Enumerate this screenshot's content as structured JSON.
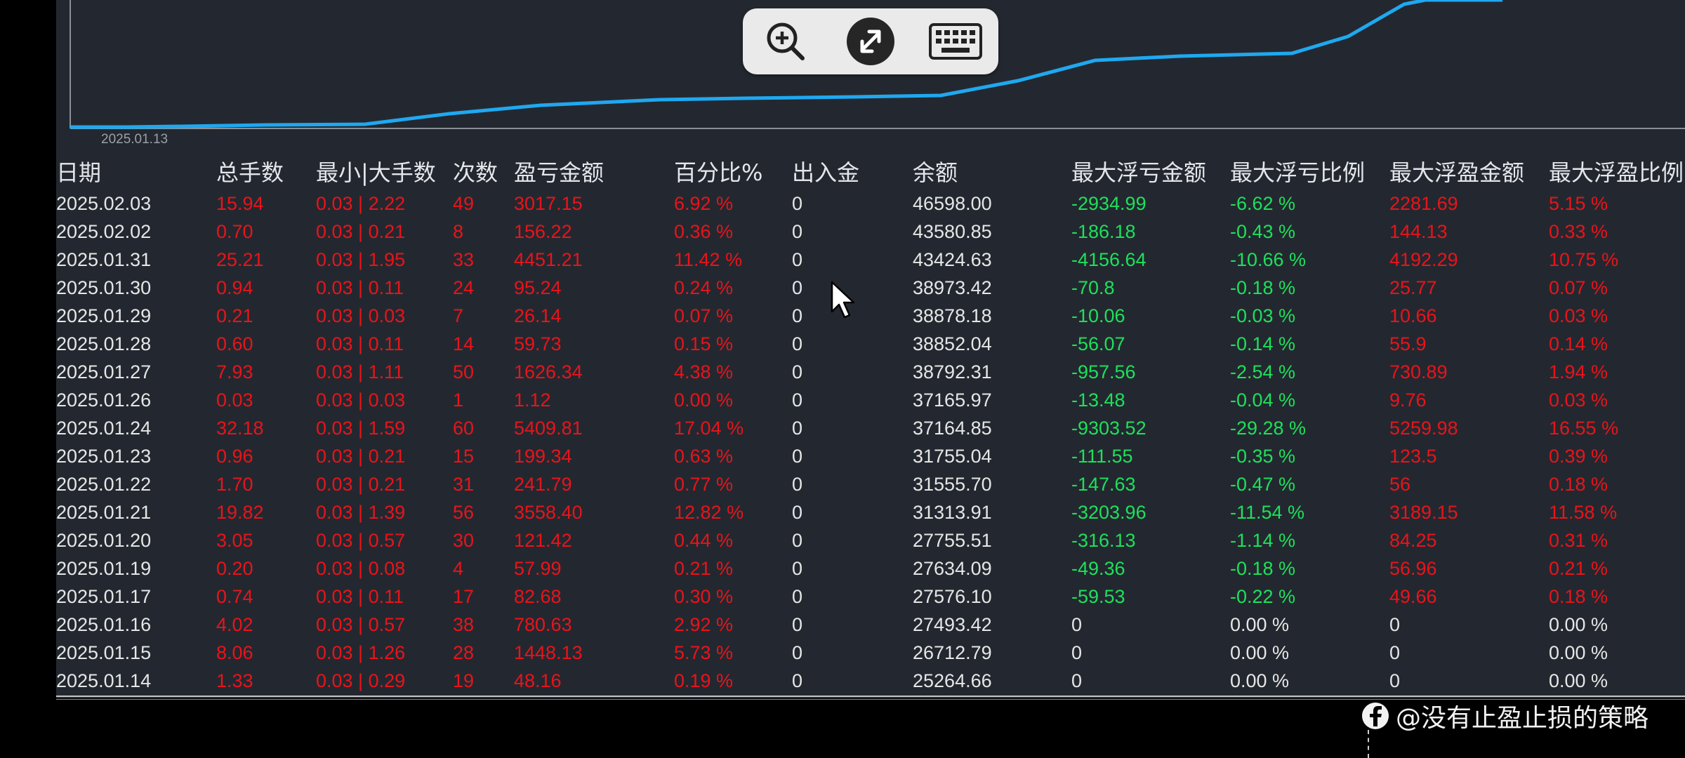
{
  "chart": {
    "axis_date": "2025.01.13",
    "line_color": "#1fa8f0"
  },
  "toolbar": {
    "zoom_icon": "zoom-in-icon",
    "remote_icon": "remote-desktop-icon",
    "keyboard_icon": "keyboard-icon"
  },
  "table": {
    "headers": [
      "日期",
      "总手数",
      "最小|大手数",
      "次数",
      "盈亏金额",
      "百分比%",
      "出入金",
      "余额",
      "最大浮亏金额",
      "最大浮亏比例",
      "最大浮盈金额",
      "最大浮盈比例"
    ],
    "rows": [
      [
        "2025.02.03",
        "15.94",
        "0.03 | 2.22",
        "49",
        "3017.15",
        "6.92 %",
        "0",
        "46598.00",
        "-2934.99",
        "-6.62 %",
        "2281.69",
        "5.15 %"
      ],
      [
        "2025.02.02",
        "0.70",
        "0.03 | 0.21",
        "8",
        "156.22",
        "0.36 %",
        "0",
        "43580.85",
        "-186.18",
        "-0.43 %",
        "144.13",
        "0.33 %"
      ],
      [
        "2025.01.31",
        "25.21",
        "0.03 | 1.95",
        "33",
        "4451.21",
        "11.42 %",
        "0",
        "43424.63",
        "-4156.64",
        "-10.66 %",
        "4192.29",
        "10.75 %"
      ],
      [
        "2025.01.30",
        "0.94",
        "0.03 | 0.11",
        "24",
        "95.24",
        "0.24 %",
        "0",
        "38973.42",
        "-70.8",
        "-0.18 %",
        "25.77",
        "0.07 %"
      ],
      [
        "2025.01.29",
        "0.21",
        "0.03 | 0.03",
        "7",
        "26.14",
        "0.07 %",
        "0",
        "38878.18",
        "-10.06",
        "-0.03 %",
        "10.66",
        "0.03 %"
      ],
      [
        "2025.01.28",
        "0.60",
        "0.03 | 0.11",
        "14",
        "59.73",
        "0.15 %",
        "0",
        "38852.04",
        "-56.07",
        "-0.14 %",
        "55.9",
        "0.14 %"
      ],
      [
        "2025.01.27",
        "7.93",
        "0.03 | 1.11",
        "50",
        "1626.34",
        "4.38 %",
        "0",
        "38792.31",
        "-957.56",
        "-2.54 %",
        "730.89",
        "1.94 %"
      ],
      [
        "2025.01.26",
        "0.03",
        "0.03 | 0.03",
        "1",
        "1.12",
        "0.00 %",
        "0",
        "37165.97",
        "-13.48",
        "-0.04 %",
        "9.76",
        "0.03 %"
      ],
      [
        "2025.01.24",
        "32.18",
        "0.03 | 1.59",
        "60",
        "5409.81",
        "17.04 %",
        "0",
        "37164.85",
        "-9303.52",
        "-29.28 %",
        "5259.98",
        "16.55 %"
      ],
      [
        "2025.01.23",
        "0.96",
        "0.03 | 0.21",
        "15",
        "199.34",
        "0.63 %",
        "0",
        "31755.04",
        "-111.55",
        "-0.35 %",
        "123.5",
        "0.39 %"
      ],
      [
        "2025.01.22",
        "1.70",
        "0.03 | 0.21",
        "31",
        "241.79",
        "0.77 %",
        "0",
        "31555.70",
        "-147.63",
        "-0.47 %",
        "56",
        "0.18 %"
      ],
      [
        "2025.01.21",
        "19.82",
        "0.03 | 1.39",
        "56",
        "3558.40",
        "12.82 %",
        "0",
        "31313.91",
        "-3203.96",
        "-11.54 %",
        "3189.15",
        "11.58 %"
      ],
      [
        "2025.01.20",
        "3.05",
        "0.03 | 0.57",
        "30",
        "121.42",
        "0.44 %",
        "0",
        "27755.51",
        "-316.13",
        "-1.14 %",
        "84.25",
        "0.31 %"
      ],
      [
        "2025.01.19",
        "0.20",
        "0.03 | 0.08",
        "4",
        "57.99",
        "0.21 %",
        "0",
        "27634.09",
        "-49.36",
        "-0.18 %",
        "56.96",
        "0.21 %"
      ],
      [
        "2025.01.17",
        "0.74",
        "0.03 | 0.11",
        "17",
        "82.68",
        "0.30 %",
        "0",
        "27576.10",
        "-59.53",
        "-0.22 %",
        "49.66",
        "0.18 %"
      ],
      [
        "2025.01.16",
        "4.02",
        "0.03 | 0.57",
        "38",
        "780.63",
        "2.92 %",
        "0",
        "27493.42",
        "0",
        "0.00 %",
        "0",
        "0.00 %"
      ],
      [
        "2025.01.15",
        "8.06",
        "0.03 | 1.26",
        "28",
        "1448.13",
        "5.73 %",
        "0",
        "26712.79",
        "0",
        "0.00 %",
        "0",
        "0.00 %"
      ],
      [
        "2025.01.14",
        "1.33",
        "0.03 | 0.29",
        "19",
        "48.16",
        "0.19 %",
        "0",
        "25264.66",
        "0",
        "0.00 %",
        "0",
        "0.00 %"
      ]
    ],
    "colors": {
      "profit": "#e8141a",
      "loss": "#1ee05a",
      "neutral": "#e6e6e6",
      "header": "#e4e6ea"
    }
  },
  "watermark": {
    "icon": "facebook-icon",
    "text": "@没有止盈止损的策略"
  }
}
